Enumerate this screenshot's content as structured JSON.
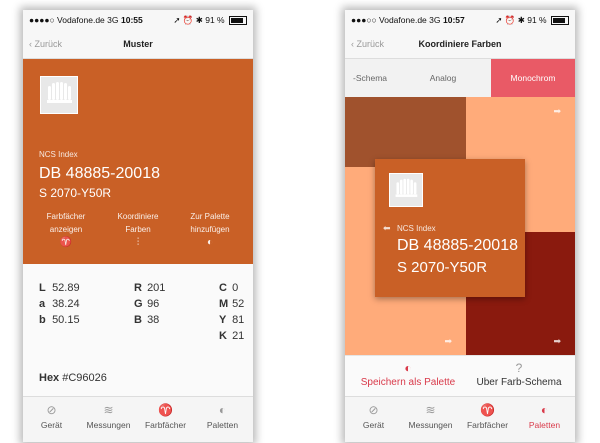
{
  "colors": {
    "swatch": "#C96026",
    "accent": "#e95a66",
    "tab_active": "#d93a4a"
  },
  "status_left": {
    "carrier": "●●●●○ Vodafone.de  3G",
    "time": "10:55",
    "right": "➚ ⏰ ✱ 91 %"
  },
  "status_right": {
    "carrier": "●●●○○ Vodafone.de  3G",
    "time": "10:57",
    "right": "➚ ⏰ ✱ 91 %"
  },
  "screen1": {
    "back": "Zurück",
    "title": "Muster",
    "ncs_label": "NCS Index",
    "ncs_code": "DB 48885-20018",
    "ncs_sub": "S 2070-Y50R",
    "actions": [
      {
        "l1": "Farbfächer",
        "l2": "anzeigen",
        "icon": "fan-icon"
      },
      {
        "l1": "Koordiniere",
        "l2": "Farben",
        "icon": "sliders-icon"
      },
      {
        "l1": "Zur Palette",
        "l2": "hinzufügen",
        "icon": "palette-icon"
      }
    ],
    "lab": [
      {
        "k": "L",
        "v": "52.89"
      },
      {
        "k": "a",
        "v": "38.24"
      },
      {
        "k": "b",
        "v": "50.15"
      }
    ],
    "rgb": [
      {
        "k": "R",
        "v": "201"
      },
      {
        "k": "G",
        "v": "96"
      },
      {
        "k": "B",
        "v": "38"
      }
    ],
    "cmyk": [
      {
        "k": "C",
        "v": "0"
      },
      {
        "k": "M",
        "v": "52"
      },
      {
        "k": "Y",
        "v": "81"
      },
      {
        "k": "K",
        "v": "21"
      }
    ],
    "hex_label": "Hex",
    "hex_value": "#C96026"
  },
  "screen2": {
    "back": "Zurück",
    "title": "Koordiniere Farben",
    "segments": [
      "-Schema",
      "Analog",
      "Monochrom"
    ],
    "active_segment": "Monochrom",
    "cells": [
      "#a0522d",
      "#ffab7a",
      "#ffab7a",
      "#8a1a0e",
      "#ffab7a",
      "#8a1a0e"
    ],
    "ncs_label": "NCS Index",
    "ncs_code": "DB 48885-20018",
    "ncs_sub": "S 2070-Y50R",
    "save": "Speichern als Palette",
    "about": "Uber Farb-Schema"
  },
  "tabs": [
    {
      "label": "Gerät",
      "icon": "circle-slash-icon"
    },
    {
      "label": "Messungen",
      "icon": "layers-icon"
    },
    {
      "label": "Farbfächer",
      "icon": "fan-icon"
    },
    {
      "label": "Paletten",
      "icon": "palette-icon"
    }
  ],
  "tab_active_left": "",
  "tab_active_right": "Paletten"
}
